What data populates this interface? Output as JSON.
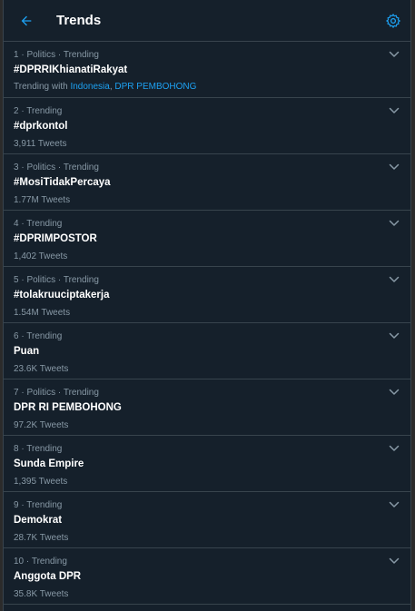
{
  "header": {
    "title": "Trends"
  },
  "trends": [
    {
      "meta": "1 · Politics · Trending",
      "name": "#DPRRIKhianatiRakyat",
      "with_prefix": "Trending with",
      "with_links": [
        "Indonesia",
        "DPR PEMBOHONG"
      ]
    },
    {
      "meta": "2 · Trending",
      "name": "#dprkontol",
      "count": "3,911 Tweets"
    },
    {
      "meta": "3 · Politics · Trending",
      "name": "#MosiTidakPercaya",
      "count": "1.77M Tweets"
    },
    {
      "meta": "4 · Trending",
      "name": "#DPRIMPOSTOR",
      "count": "1,402 Tweets"
    },
    {
      "meta": "5 · Politics · Trending",
      "name": "#tolakruuciptakerja",
      "count": "1.54M Tweets"
    },
    {
      "meta": "6 · Trending",
      "name": "Puan",
      "count": "23.6K Tweets"
    },
    {
      "meta": "7 · Politics · Trending",
      "name": "DPR RI PEMBOHONG",
      "count": "97.2K Tweets"
    },
    {
      "meta": "8 · Trending",
      "name": "Sunda Empire",
      "count": "1,395 Tweets"
    },
    {
      "meta": "9 · Trending",
      "name": "Demokrat",
      "count": "28.7K Tweets"
    },
    {
      "meta": "10 · Trending",
      "name": "Anggota DPR",
      "count": "35.8K Tweets"
    }
  ],
  "colors": {
    "accent": "#1da1f2",
    "background": "#15202b",
    "border": "#38444d",
    "secondary_text": "#8899a6"
  },
  "icons": {
    "back": "arrow-left-icon",
    "settings": "gear-icon",
    "more": "chevron-down-icon"
  }
}
